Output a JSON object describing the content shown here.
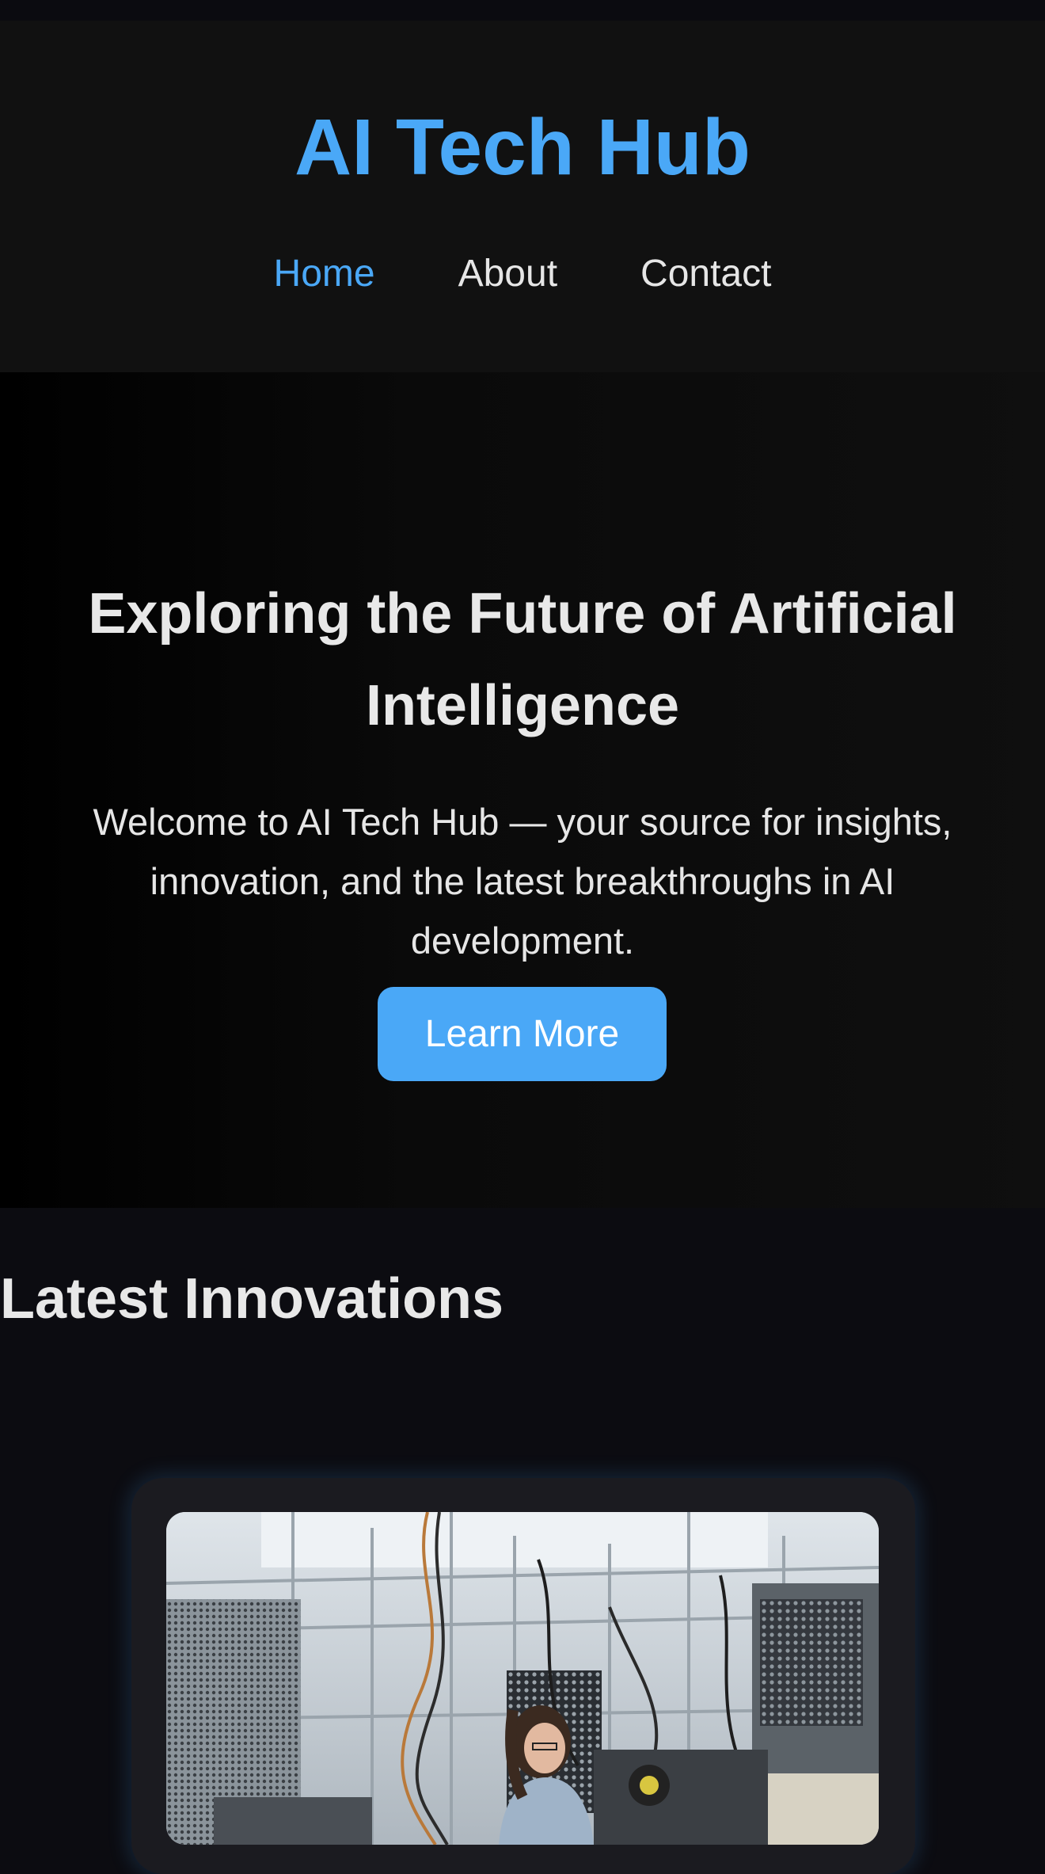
{
  "header": {
    "site_title": "AI Tech Hub",
    "nav": [
      {
        "label": "Home",
        "active": true
      },
      {
        "label": "About",
        "active": false
      },
      {
        "label": "Contact",
        "active": false
      }
    ]
  },
  "hero": {
    "title": "Exploring the Future of Artificial Intelligence",
    "subtitle": "Welcome to AI Tech Hub — your source for insights, innovation, and the latest breakthroughs in AI development.",
    "cta_label": "Learn More"
  },
  "innovations": {
    "section_title": "Latest Innovations",
    "cards": [
      {
        "image": "photo of a woman working in a robotics lab surrounded by metal framework and cables"
      }
    ]
  },
  "colors": {
    "accent": "#4aa8f7",
    "header_bg": "#111111",
    "page_bg": "#0c0c11",
    "card_bg": "#1b1b20",
    "text": "#e6e6e6"
  }
}
